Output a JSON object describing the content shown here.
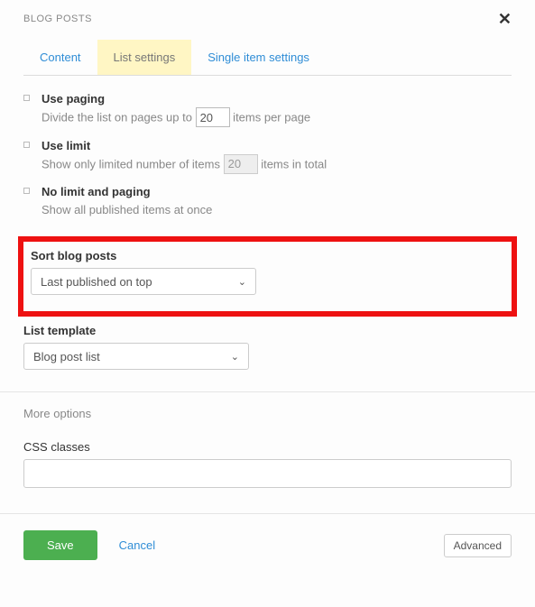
{
  "header": {
    "title": "BLOG POSTS"
  },
  "tabs": {
    "content": "Content",
    "list_settings": "List settings",
    "single_item": "Single item settings"
  },
  "paging": {
    "title": "Use paging",
    "desc_pre": "Divide the list on pages up to ",
    "value": "20",
    "desc_post": " items per page"
  },
  "limit": {
    "title": "Use limit",
    "desc_pre": "Show only limited number of items ",
    "value": "20",
    "desc_post": " items in total"
  },
  "nolimit": {
    "title": "No limit and paging",
    "desc": "Show all published items at once"
  },
  "sort": {
    "label": "Sort blog posts",
    "value": "Last published on top"
  },
  "template": {
    "label": "List template",
    "value": "Blog post list"
  },
  "more_options": "More options",
  "css": {
    "label": "CSS classes",
    "value": ""
  },
  "footer": {
    "save": "Save",
    "cancel": "Cancel",
    "advanced": "Advanced"
  }
}
